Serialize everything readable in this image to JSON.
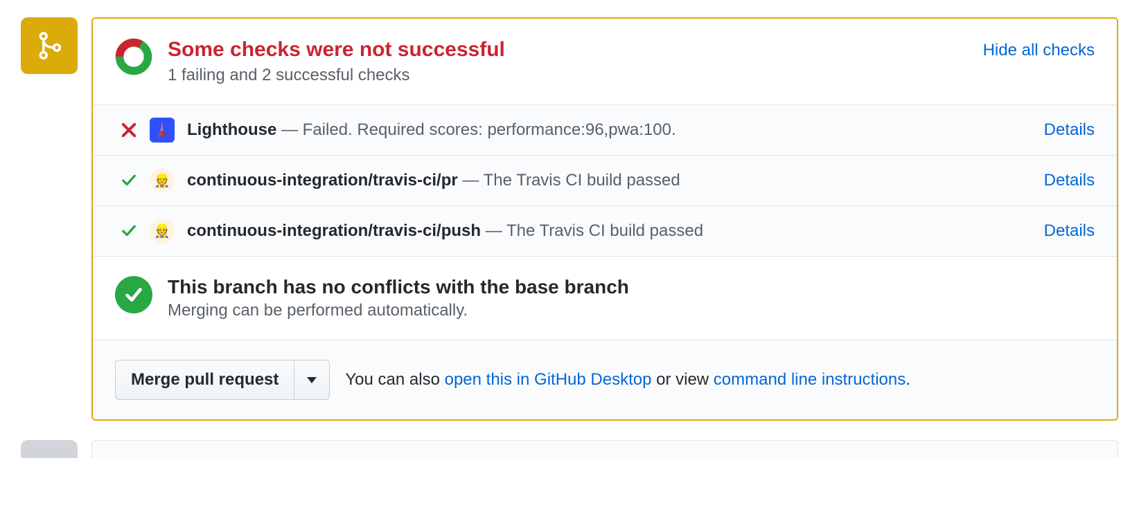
{
  "header": {
    "title": "Some checks were not successful",
    "subtitle": "1 failing and 2 successful checks",
    "hide_link": "Hide all checks"
  },
  "checks": [
    {
      "status": "fail",
      "app": "lighthouse",
      "app_emoji": "🗼",
      "name": "Lighthouse",
      "message": "Failed. Required scores: performance:96,pwa:100.",
      "details_label": "Details"
    },
    {
      "status": "pass",
      "app": "travis",
      "app_emoji": "👷",
      "name": "continuous-integration/travis-ci/pr",
      "message": "The Travis CI build passed",
      "details_label": "Details"
    },
    {
      "status": "pass",
      "app": "travis",
      "app_emoji": "👷",
      "name": "continuous-integration/travis-ci/push",
      "message": "The Travis CI build passed",
      "details_label": "Details"
    }
  ],
  "conflicts": {
    "title": "This branch has no conflicts with the base branch",
    "subtitle": "Merging can be performed automatically."
  },
  "footer": {
    "merge_button": "Merge pull request",
    "prefix": "You can also ",
    "desktop_link": "open this in GitHub Desktop",
    "middle": " or view ",
    "cli_link": "command line instructions",
    "suffix": "."
  }
}
